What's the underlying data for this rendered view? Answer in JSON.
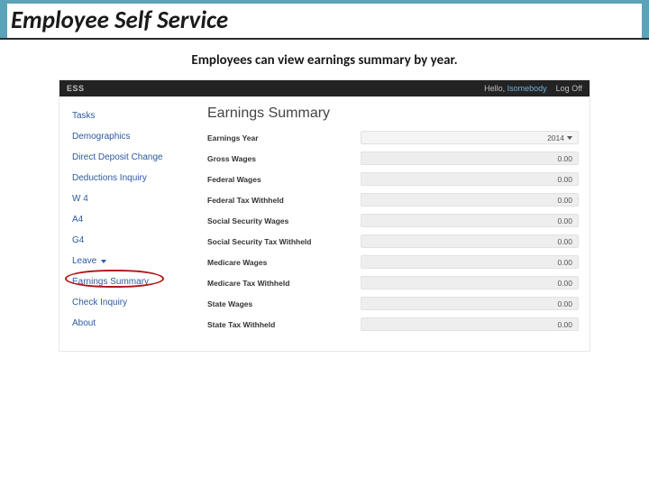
{
  "slide": {
    "title": "Employee Self Service",
    "caption": "Employees can view earnings summary by year."
  },
  "topbar": {
    "brand": "ESS",
    "greeting": "Hello,",
    "username": "Isomebody",
    "logoff": "Log Off"
  },
  "sidebar": {
    "items": [
      {
        "label": "Tasks"
      },
      {
        "label": "Demographics"
      },
      {
        "label": "Direct Deposit Change"
      },
      {
        "label": "Deductions Inquiry"
      },
      {
        "label": "W 4"
      },
      {
        "label": "A4"
      },
      {
        "label": "G4"
      },
      {
        "label": "Leave",
        "dropdown": true
      },
      {
        "label": "Earnings Summary",
        "highlighted": true
      },
      {
        "label": "Check Inquiry"
      },
      {
        "label": "About"
      }
    ]
  },
  "main": {
    "heading": "Earnings Summary",
    "year_label": "Earnings Year",
    "year_value": "2014",
    "rows": [
      {
        "label": "Gross Wages",
        "value": "0.00"
      },
      {
        "label": "Federal Wages",
        "value": "0.00"
      },
      {
        "label": "Federal Tax Withheld",
        "value": "0.00"
      },
      {
        "label": "Social Security Wages",
        "value": "0.00"
      },
      {
        "label": "Social Security Tax Withheld",
        "value": "0.00"
      },
      {
        "label": "Medicare Wages",
        "value": "0.00"
      },
      {
        "label": "Medicare Tax Withheld",
        "value": "0.00"
      },
      {
        "label": "State Wages",
        "value": "0.00"
      },
      {
        "label": "State Tax Withheld",
        "value": "0.00"
      }
    ]
  }
}
